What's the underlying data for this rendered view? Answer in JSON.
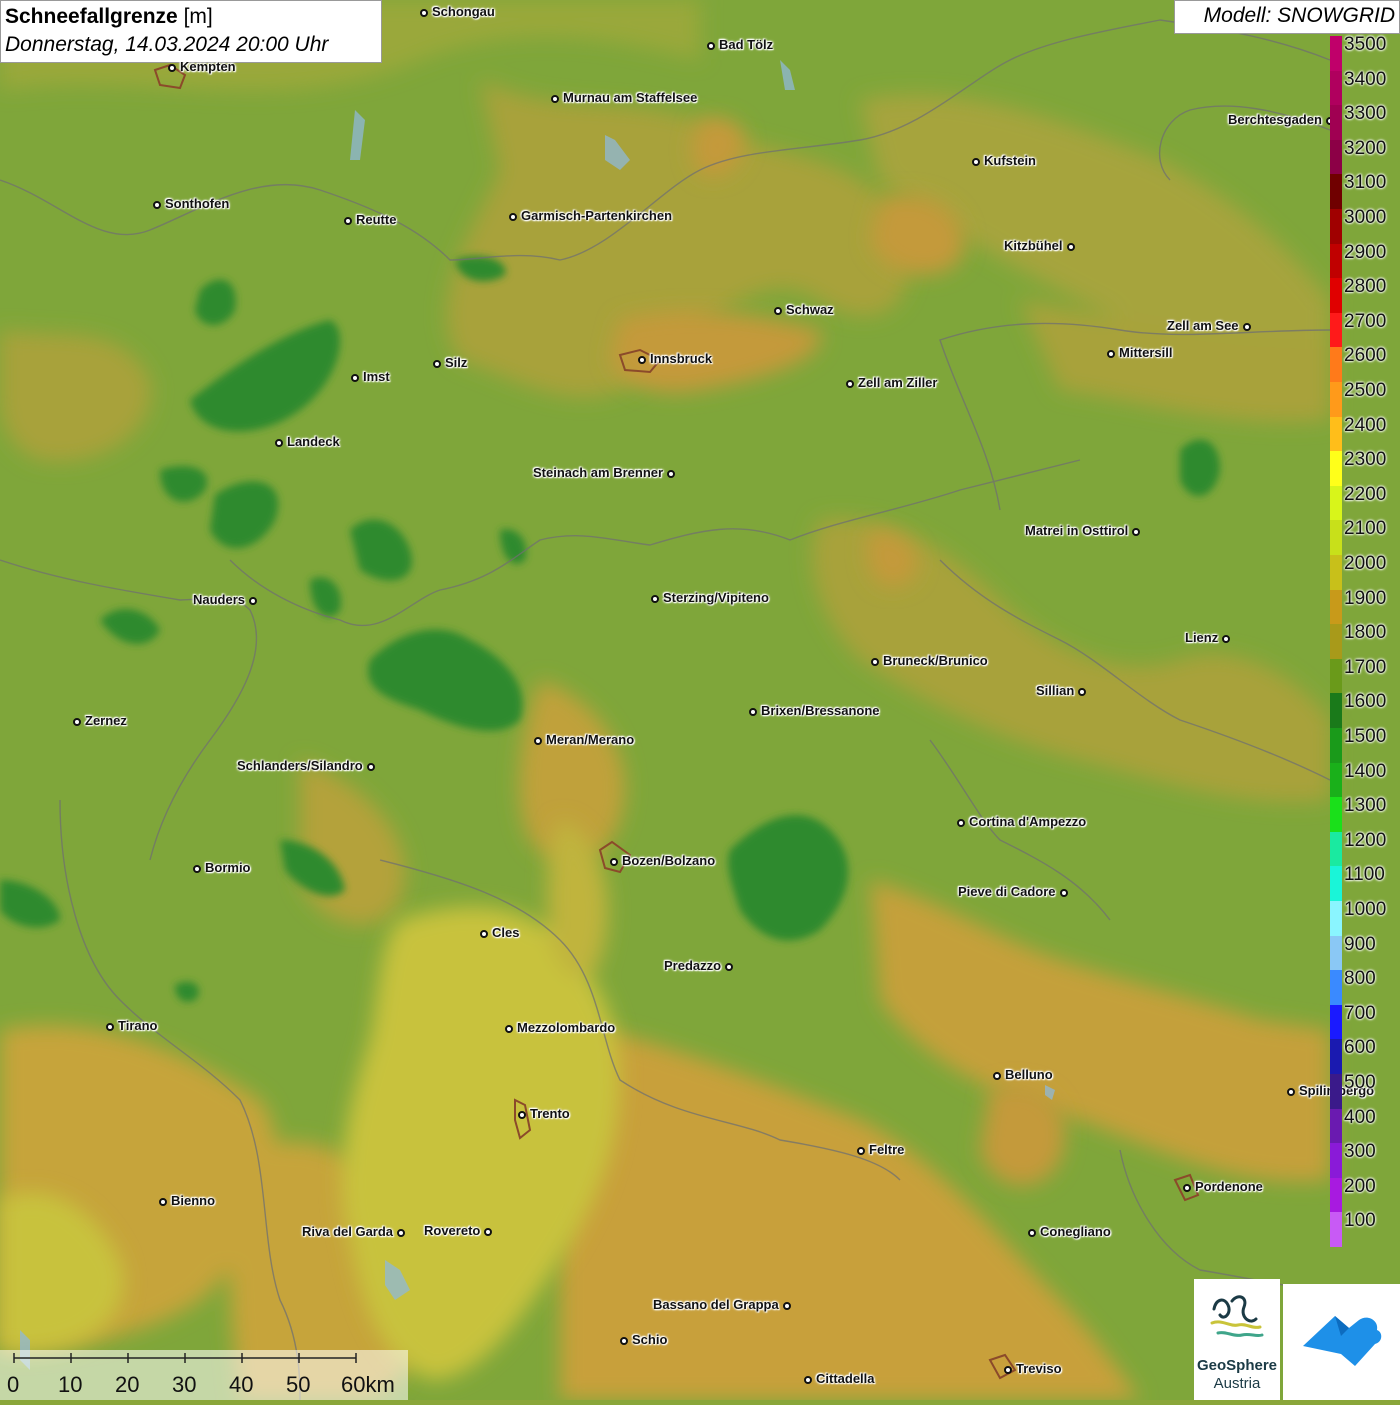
{
  "title": {
    "label": "Schneefallgrenze",
    "unit": "[m]",
    "datetime": "Donnerstag, 14.03.2024 20:00 Uhr"
  },
  "model": "Modell: SNOWGRID",
  "legend": {
    "values": [
      "3500",
      "3400",
      "3300",
      "3200",
      "3100",
      "3000",
      "2900",
      "2800",
      "2700",
      "2600",
      "2500",
      "2400",
      "2300",
      "2200",
      "2100",
      "2000",
      "1900",
      "1800",
      "1700",
      "1600",
      "1500",
      "1400",
      "1300",
      "1200",
      "1100",
      "1000",
      "900",
      "800",
      "700",
      "600",
      "500",
      "400",
      "300",
      "200",
      "100"
    ],
    "colors": [
      "#c0006a",
      "#b0005e",
      "#a00052",
      "#8c0046",
      "#700000",
      "#a00000",
      "#c00000",
      "#e00000",
      "#ff1a1a",
      "#ff7a1a",
      "#ff9a1a",
      "#ffbe1a",
      "#ffff1a",
      "#d8f51a",
      "#c8e01a",
      "#c8c01a",
      "#c89a1a",
      "#a89a1a",
      "#6a9a1a",
      "#1a7a1a",
      "#1a9a1a",
      "#1ab01a",
      "#1ae01a",
      "#1aeaa0",
      "#1af5d8",
      "#8af5ff",
      "#8ac8f5",
      "#3a8aff",
      "#1a1aff",
      "#1a1ab0",
      "#3a1a8a",
      "#6a1ab0",
      "#8a1ad8",
      "#a81ae0",
      "#c85af5"
    ]
  },
  "cities": [
    {
      "name": "Schongau",
      "label_side": "right"
    },
    {
      "name": "Bad Tölz",
      "label_side": "right"
    },
    {
      "name": "Kempten",
      "label_side": "right"
    },
    {
      "name": "Murnau am Staffelsee",
      "label_side": "right"
    },
    {
      "name": "Berchtesgaden",
      "label_side": "left"
    },
    {
      "name": "Kufstein",
      "label_side": "right"
    },
    {
      "name": "Sonthofen",
      "label_side": "right"
    },
    {
      "name": "Reutte",
      "label_side": "right"
    },
    {
      "name": "Garmisch-Partenkirchen",
      "label_side": "right"
    },
    {
      "name": "Kitzbühel",
      "label_side": "left"
    },
    {
      "name": "Schwaz",
      "label_side": "right"
    },
    {
      "name": "Zell am See",
      "label_side": "left"
    },
    {
      "name": "Innsbruck",
      "label_side": "right"
    },
    {
      "name": "Mittersill",
      "label_side": "right"
    },
    {
      "name": "Imst",
      "label_side": "right"
    },
    {
      "name": "Silz",
      "label_side": "right"
    },
    {
      "name": "Zell am Ziller",
      "label_side": "right"
    },
    {
      "name": "Landeck",
      "label_side": "right"
    },
    {
      "name": "Steinach am Brenner",
      "label_side": "left"
    },
    {
      "name": "Matrei in Osttirol",
      "label_side": "left"
    },
    {
      "name": "Nauders",
      "label_side": "left"
    },
    {
      "name": "Sterzing/Vipiteno",
      "label_side": "right"
    },
    {
      "name": "Lienz",
      "label_side": "left"
    },
    {
      "name": "Bruneck/Brunico",
      "label_side": "right"
    },
    {
      "name": "Sillian",
      "label_side": "left"
    },
    {
      "name": "Brixen/Bressanone",
      "label_side": "right"
    },
    {
      "name": "Zernez",
      "label_side": "right"
    },
    {
      "name": "Meran/Merano",
      "label_side": "right"
    },
    {
      "name": "Schlanders/Silandro",
      "label_side": "left"
    },
    {
      "name": "Cortina d'Ampezzo",
      "label_side": "right"
    },
    {
      "name": "Bozen/Bolzano",
      "label_side": "right"
    },
    {
      "name": "Bormio",
      "label_side": "right"
    },
    {
      "name": "Pieve di Cadore",
      "label_side": "left"
    },
    {
      "name": "Cles",
      "label_side": "right"
    },
    {
      "name": "Predazzo",
      "label_side": "left"
    },
    {
      "name": "Tirano",
      "label_side": "right"
    },
    {
      "name": "Mezzolombardo",
      "label_side": "right"
    },
    {
      "name": "Belluno",
      "label_side": "right"
    },
    {
      "name": "Spilimbergo",
      "label_side": "right"
    },
    {
      "name": "Trento",
      "label_side": "right"
    },
    {
      "name": "Feltre",
      "label_side": "right"
    },
    {
      "name": "Pordenone",
      "label_side": "right"
    },
    {
      "name": "Bienno",
      "label_side": "right"
    },
    {
      "name": "Riva del Garda",
      "label_side": "left"
    },
    {
      "name": "Rovereto",
      "label_side": "left"
    },
    {
      "name": "Conegliano",
      "label_side": "right"
    },
    {
      "name": "Bassano del Grappa",
      "label_side": "left"
    },
    {
      "name": "Schio",
      "label_side": "right"
    },
    {
      "name": "Treviso",
      "label_side": "right"
    },
    {
      "name": "Cittadella",
      "label_side": "right"
    }
  ],
  "scale": {
    "ticks": [
      "0",
      "10",
      "20",
      "30",
      "40",
      "50",
      "60km"
    ]
  },
  "logos": {
    "geosphere_line1": "GeoSphere",
    "geosphere_line2": "Austria"
  }
}
